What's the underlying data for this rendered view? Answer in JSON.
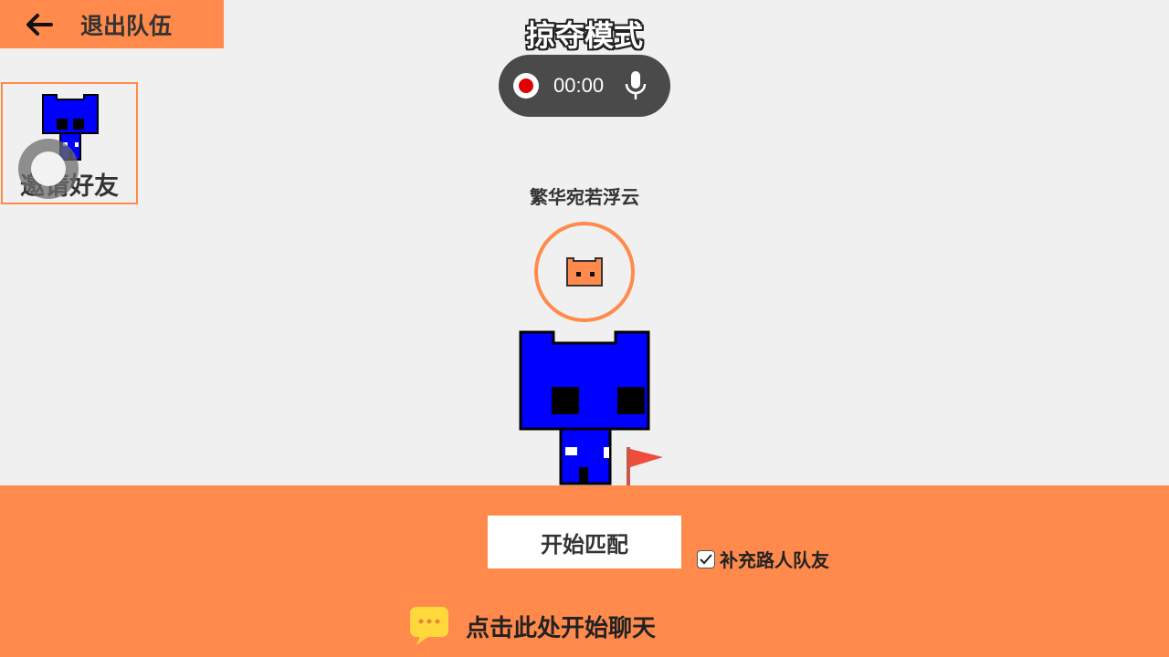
{
  "header": {
    "exit_label": "退出队伍",
    "mode_title": "掠夺模式"
  },
  "recorder": {
    "time": "00:00"
  },
  "invite": {
    "label": "邀请好友"
  },
  "player": {
    "name": "繁华宛若浮云"
  },
  "bottom": {
    "start_label": "开始匹配",
    "fill_label": "补充路人队友",
    "fill_checked": true,
    "chat_label": "点击此处开始聊天"
  },
  "colors": {
    "accent": "#ff8a4c",
    "character_blue": "#0000ff",
    "record_red": "#e00000",
    "chat_yellow": "#ffd93b",
    "flag_red": "#ef4d3c"
  },
  "icons": {
    "back": "arrow-left-icon",
    "record": "record-icon",
    "mic": "microphone-icon",
    "chat": "chat-bubble-icon",
    "check": "checkmark-icon",
    "flag": "flag-icon"
  }
}
